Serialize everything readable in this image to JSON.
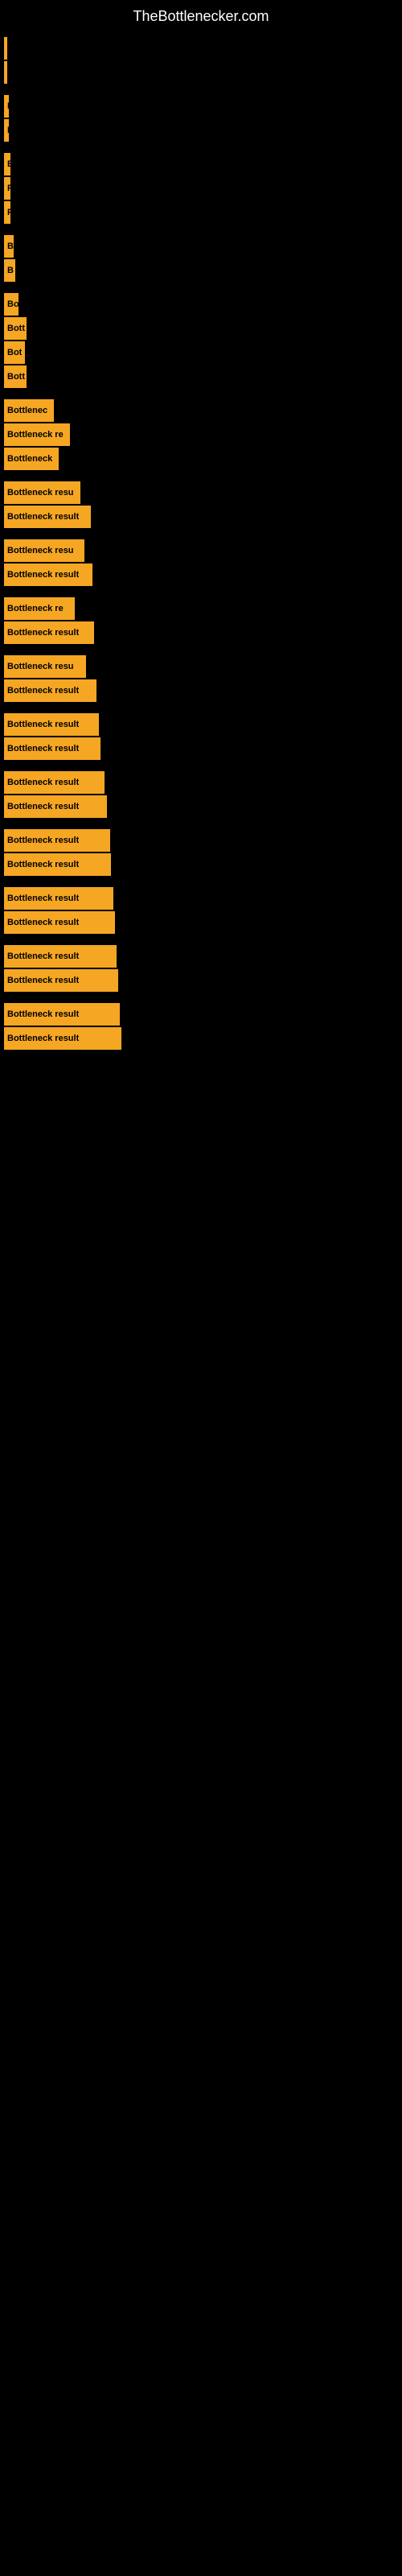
{
  "site": {
    "title": "TheBottlenecker.com"
  },
  "bars": [
    {
      "id": 1,
      "label": "",
      "width": 4,
      "gap": false
    },
    {
      "id": 2,
      "label": "",
      "width": 4,
      "gap": true
    },
    {
      "id": 3,
      "label": "F",
      "width": 6,
      "gap": false
    },
    {
      "id": 4,
      "label": "F",
      "width": 6,
      "gap": true
    },
    {
      "id": 5,
      "label": "B",
      "width": 8,
      "gap": false
    },
    {
      "id": 6,
      "label": "F",
      "width": 8,
      "gap": false
    },
    {
      "id": 7,
      "label": "F",
      "width": 8,
      "gap": true
    },
    {
      "id": 8,
      "label": "B",
      "width": 12,
      "gap": false
    },
    {
      "id": 9,
      "label": "B",
      "width": 14,
      "gap": true
    },
    {
      "id": 10,
      "label": "Bo",
      "width": 18,
      "gap": false
    },
    {
      "id": 11,
      "label": "Bott",
      "width": 28,
      "gap": false
    },
    {
      "id": 12,
      "label": "Bot",
      "width": 26,
      "gap": false
    },
    {
      "id": 13,
      "label": "Bott",
      "width": 28,
      "gap": true
    },
    {
      "id": 14,
      "label": "Bottlenec",
      "width": 62,
      "gap": false
    },
    {
      "id": 15,
      "label": "Bottleneck re",
      "width": 82,
      "gap": false
    },
    {
      "id": 16,
      "label": "Bottleneck",
      "width": 68,
      "gap": true
    },
    {
      "id": 17,
      "label": "Bottleneck resu",
      "width": 95,
      "gap": false
    },
    {
      "id": 18,
      "label": "Bottleneck result",
      "width": 108,
      "gap": true
    },
    {
      "id": 19,
      "label": "Bottleneck resu",
      "width": 100,
      "gap": false
    },
    {
      "id": 20,
      "label": "Bottleneck result",
      "width": 110,
      "gap": true
    },
    {
      "id": 21,
      "label": "Bottleneck re",
      "width": 88,
      "gap": false
    },
    {
      "id": 22,
      "label": "Bottleneck result",
      "width": 112,
      "gap": true
    },
    {
      "id": 23,
      "label": "Bottleneck resu",
      "width": 102,
      "gap": false
    },
    {
      "id": 24,
      "label": "Bottleneck result",
      "width": 115,
      "gap": true
    },
    {
      "id": 25,
      "label": "Bottleneck result",
      "width": 118,
      "gap": false
    },
    {
      "id": 26,
      "label": "Bottleneck result",
      "width": 120,
      "gap": true
    },
    {
      "id": 27,
      "label": "Bottleneck result",
      "width": 125,
      "gap": false
    },
    {
      "id": 28,
      "label": "Bottleneck result",
      "width": 128,
      "gap": true
    },
    {
      "id": 29,
      "label": "Bottleneck result",
      "width": 132,
      "gap": false
    },
    {
      "id": 30,
      "label": "Bottleneck result",
      "width": 133,
      "gap": true
    },
    {
      "id": 31,
      "label": "Bottleneck result",
      "width": 136,
      "gap": false
    },
    {
      "id": 32,
      "label": "Bottleneck result",
      "width": 138,
      "gap": true
    },
    {
      "id": 33,
      "label": "Bottleneck result",
      "width": 140,
      "gap": false
    },
    {
      "id": 34,
      "label": "Bottleneck result",
      "width": 142,
      "gap": true
    },
    {
      "id": 35,
      "label": "Bottleneck result",
      "width": 144,
      "gap": false
    },
    {
      "id": 36,
      "label": "Bottleneck result",
      "width": 146,
      "gap": true
    }
  ]
}
